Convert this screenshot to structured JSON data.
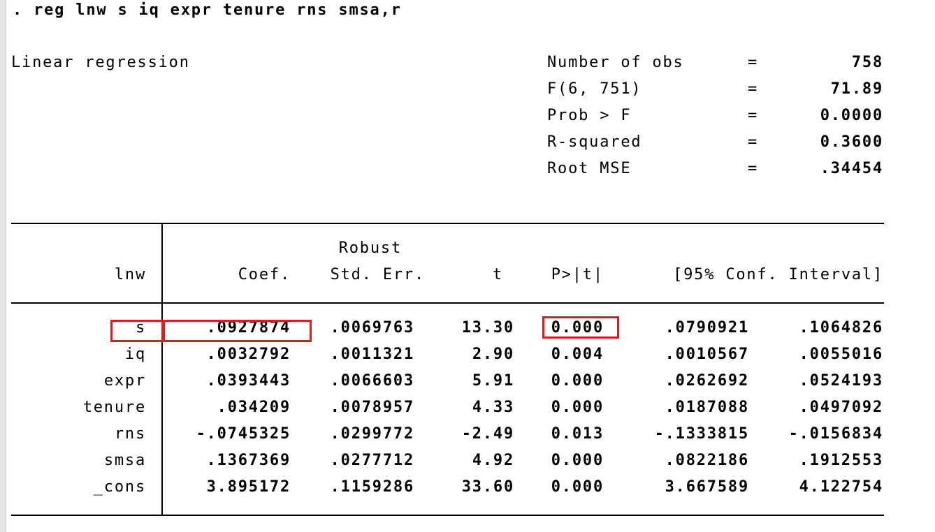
{
  "command": ". reg lnw s iq expr tenure rns smsa,r",
  "model_title": "Linear regression",
  "stats": [
    {
      "label": "Number of obs",
      "eq": "=",
      "value": "758"
    },
    {
      "label": "F(6, 751)",
      "eq": "=",
      "value": "71.89"
    },
    {
      "label": "Prob > F",
      "eq": "=",
      "value": "0.0000"
    },
    {
      "label": "R-squared",
      "eq": "=",
      "value": "0.3600"
    },
    {
      "label": "Root MSE",
      "eq": "=",
      "value": ".34454"
    }
  ],
  "table": {
    "depvar": "lnw",
    "header_top": "Robust",
    "columns": [
      "Coef.",
      "Std. Err.",
      "t",
      "P>|t|",
      "[95% Conf. Interval]"
    ],
    "rows": [
      {
        "var": "s",
        "coef": ".0927874",
        "se": ".0069763",
        "t": "13.30",
        "p": "0.000",
        "lo": ".0790921",
        "hi": ".1064826"
      },
      {
        "var": "iq",
        "coef": ".0032792",
        "se": ".0011321",
        "t": "2.90",
        "p": "0.004",
        "lo": ".0010567",
        "hi": ".0055016"
      },
      {
        "var": "expr",
        "coef": ".0393443",
        "se": ".0066603",
        "t": "5.91",
        "p": "0.000",
        "lo": ".0262692",
        "hi": ".0524193"
      },
      {
        "var": "tenure",
        "coef": ".034209",
        "se": ".0078957",
        "t": "4.33",
        "p": "0.000",
        "lo": ".0187088",
        "hi": ".0497092"
      },
      {
        "var": "rns",
        "coef": "-.0745325",
        "se": ".0299772",
        "t": "-2.49",
        "p": "0.013",
        "lo": "-.1333815",
        "hi": "-.0156834"
      },
      {
        "var": "smsa",
        "coef": ".1367369",
        "se": ".0277712",
        "t": "4.92",
        "p": "0.000",
        "lo": ".0822186",
        "hi": ".1912553"
      },
      {
        "var": "_cons",
        "coef": "3.895172",
        "se": ".1159286",
        "t": "33.60",
        "p": "0.000",
        "lo": "3.667589",
        "hi": "4.122754"
      }
    ]
  },
  "highlight_color": "#e01b1b"
}
